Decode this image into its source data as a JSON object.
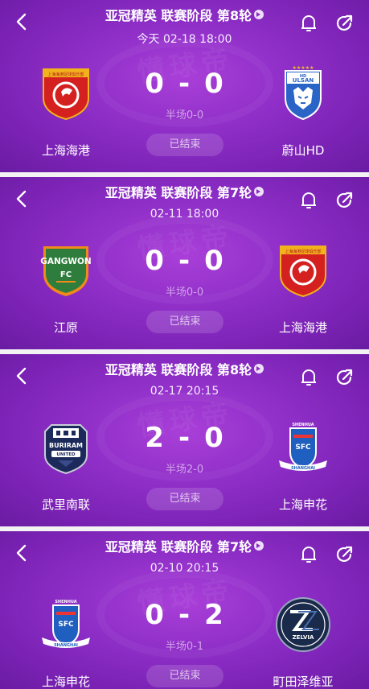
{
  "watermark": "懂球帝",
  "matches": [
    {
      "title": "亚冠精英 联赛阶段 第8轮",
      "time": "今天 02-18 18:00",
      "home": {
        "name": "上海海港",
        "logo": "shanghai-port-logo"
      },
      "away": {
        "name": "蔚山HD",
        "logo": "ulsan-hd-logo"
      },
      "score_home": "0",
      "score_away": "0",
      "half": "半场0-0",
      "status": "已结束"
    },
    {
      "title": "亚冠精英 联赛阶段 第7轮",
      "time": "02-11 18:00",
      "home": {
        "name": "江原",
        "logo": "gangwon-fc-logo"
      },
      "away": {
        "name": "上海海港",
        "logo": "shanghai-port-logo"
      },
      "score_home": "0",
      "score_away": "0",
      "half": "半场0-0",
      "status": "已结束"
    },
    {
      "title": "亚冠精英 联赛阶段 第8轮",
      "time": "02-17 20:15",
      "home": {
        "name": "武里南联",
        "logo": "buriram-united-logo"
      },
      "away": {
        "name": "上海申花",
        "logo": "shanghai-shenhua-logo"
      },
      "score_home": "2",
      "score_away": "0",
      "half": "半场2-0",
      "status": "已结束"
    },
    {
      "title": "亚冠精英 联赛阶段 第7轮",
      "time": "02-10 20:15",
      "home": {
        "name": "上海申花",
        "logo": "shanghai-shenhua-logo"
      },
      "away": {
        "name": "町田泽维亚",
        "logo": "machida-zelvia-logo"
      },
      "score_home": "0",
      "score_away": "2",
      "half": "半场0-1",
      "status": "已结束"
    }
  ],
  "logo_text": {
    "port_banner": "上海海港足球俱乐部",
    "ulsan_top": "HD",
    "ulsan_main": "ULSAN",
    "gangwon_main": "GANGWON",
    "gangwon_fc": "FC",
    "buriram_main": "BURIRAM",
    "buriram_sub": "UNITED",
    "shenhua_top": "SHENHUA",
    "shenhua_mid": "SFC",
    "shenhua_bottom": "SHANGHAI",
    "zelvia_main": "ZELVIA"
  },
  "colors": {
    "card_bg": "#8f2fc8",
    "port_red": "#d4201f",
    "port_gold": "#f2b21c",
    "ulsan_blue": "#2a64c6",
    "gangwon_green": "#2e7d3c",
    "gangwon_orange": "#f08a1a",
    "buriram_navy": "#1b2a5a",
    "shenhua_blue": "#1f5fc0",
    "zelvia_navy": "#1a2a4a"
  }
}
